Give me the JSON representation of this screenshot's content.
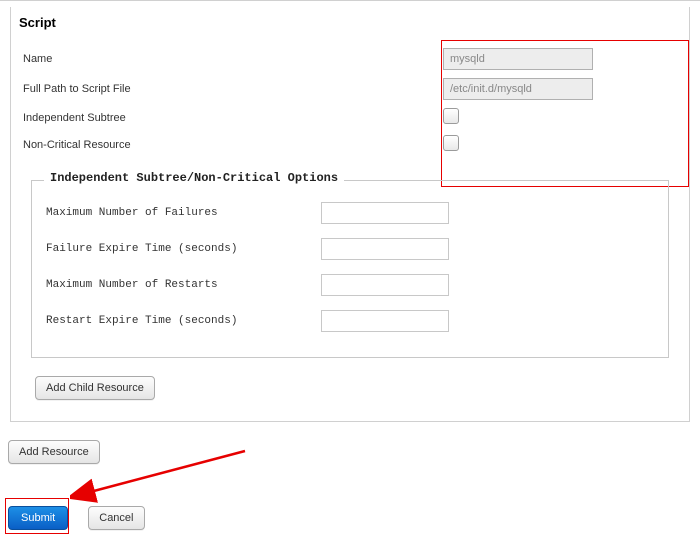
{
  "section": {
    "title": "Script"
  },
  "fields": {
    "name_label": "Name",
    "name_value": "mysqld",
    "path_label": "Full Path to Script File",
    "path_value": "/etc/init.d/mysqld",
    "ind_subtree_label": "Independent Subtree",
    "noncrit_label": "Non-Critical Resource"
  },
  "subtree": {
    "legend": "Independent Subtree/Non-Critical Options",
    "max_failures_label": "Maximum Number of Failures",
    "failure_expire_label": "Failure Expire Time (seconds)",
    "max_restarts_label": "Maximum Number of Restarts",
    "restart_expire_label": "Restart Expire Time (seconds)"
  },
  "buttons": {
    "add_child": "Add Child Resource",
    "add_resource": "Add Resource",
    "submit": "Submit",
    "cancel": "Cancel"
  }
}
